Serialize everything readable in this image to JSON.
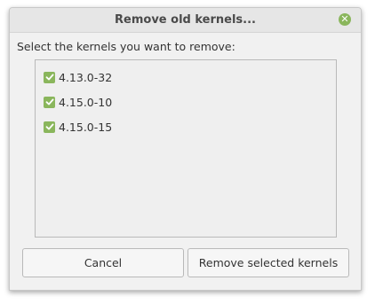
{
  "window": {
    "title": "Remove old kernels..."
  },
  "dialog": {
    "prompt": "Select the kernels you want to remove:",
    "kernels": [
      {
        "label": "4.13.0-32",
        "checked": true
      },
      {
        "label": "4.15.0-10",
        "checked": true
      },
      {
        "label": "4.15.0-15",
        "checked": true
      }
    ],
    "cancel_label": "Cancel",
    "remove_label": "Remove selected kernels"
  },
  "colors": {
    "accent": "#8ab65c"
  },
  "icons": {
    "close": "close-icon",
    "check": "checkmark-icon"
  }
}
